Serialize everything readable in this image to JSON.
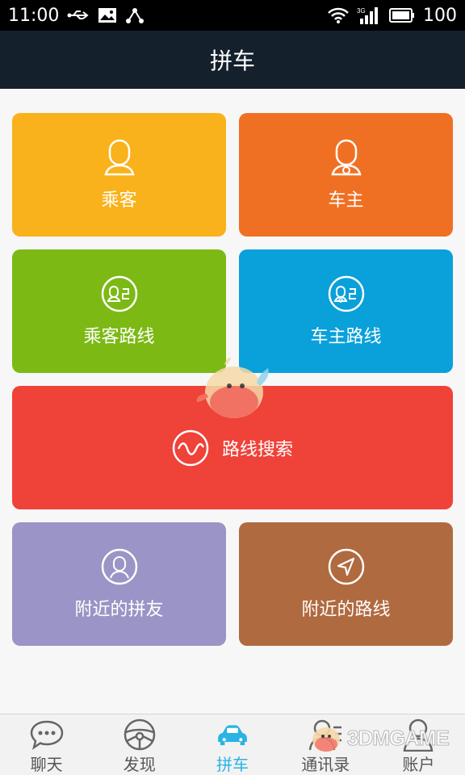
{
  "status_bar": {
    "time": "11:00",
    "battery": "100",
    "network": "3G"
  },
  "title": "拼车",
  "tiles": [
    {
      "label": "乘客",
      "color": "#f9b21b",
      "icon": "passenger-icon"
    },
    {
      "label": "车主",
      "color": "#f07023",
      "icon": "driver-icon"
    },
    {
      "label": "乘客路线",
      "color": "#7cb915",
      "icon": "passenger-route-icon"
    },
    {
      "label": "车主路线",
      "color": "#0aa0da",
      "icon": "driver-route-icon"
    },
    {
      "label": "路线搜索",
      "color": "#ef4239",
      "icon": "route-search-icon"
    },
    {
      "label": "附近的拼友",
      "color": "#9a95c6",
      "icon": "nearby-friends-icon"
    },
    {
      "label": "附近的路线",
      "color": "#b06a40",
      "icon": "nearby-routes-icon"
    }
  ],
  "tabs": [
    {
      "label": "聊天",
      "icon": "chat-icon",
      "active": false
    },
    {
      "label": "发现",
      "icon": "steering-wheel-icon",
      "active": false
    },
    {
      "label": "拼车",
      "icon": "car-icon",
      "active": true
    },
    {
      "label": "通讯录",
      "icon": "contacts-icon",
      "active": false
    },
    {
      "label": "账户",
      "icon": "account-icon",
      "active": false
    }
  ],
  "watermark": "3DMGAME",
  "colors": {
    "title_bar": "#15202d",
    "active_tab": "#2ab3e4"
  }
}
